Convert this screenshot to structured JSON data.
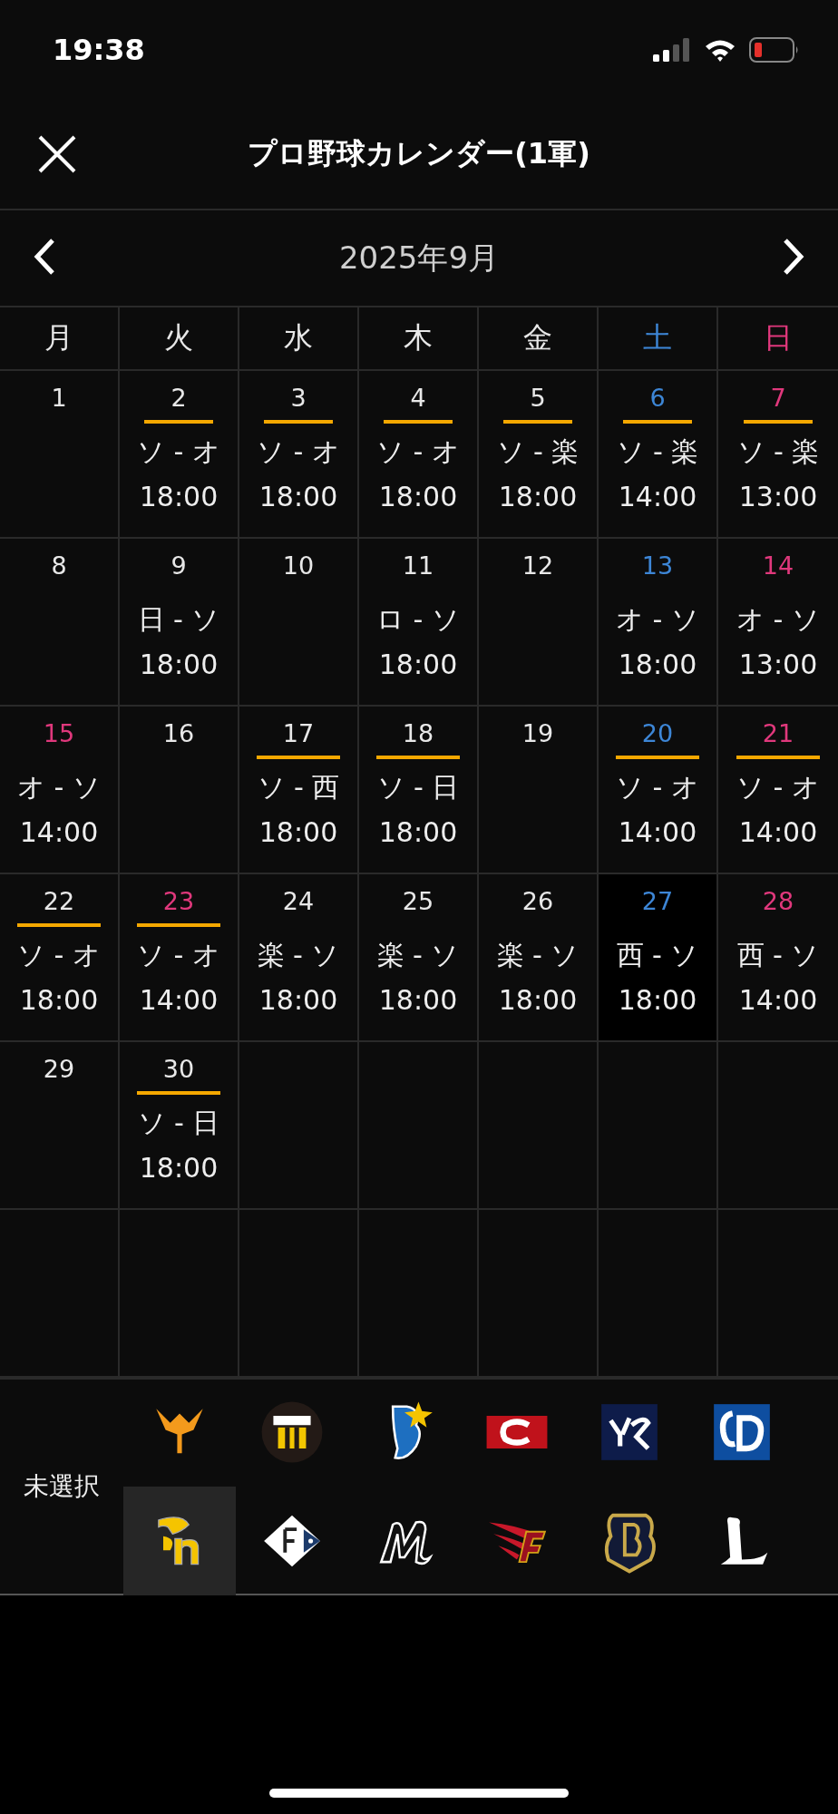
{
  "status_bar": {
    "time": "19:38"
  },
  "header": {
    "title": "プロ野球カレンダー(1軍)"
  },
  "month_nav": {
    "label": "2025年9月"
  },
  "weekdays": [
    {
      "label": "月",
      "color": "#e8e8e8"
    },
    {
      "label": "火",
      "color": "#e8e8e8"
    },
    {
      "label": "水",
      "color": "#e8e8e8"
    },
    {
      "label": "木",
      "color": "#e8e8e8"
    },
    {
      "label": "金",
      "color": "#e8e8e8"
    },
    {
      "label": "土",
      "color": "#3d86d6"
    },
    {
      "label": "日",
      "color": "#e0387c"
    }
  ],
  "weeks": [
    [
      {
        "day": "1",
        "color": "#e8e8e8",
        "home_game": false,
        "selected": false
      },
      {
        "day": "2",
        "color": "#e8e8e8",
        "home_game": true,
        "selected": false,
        "matchup": "ソ - オ",
        "time": "18:00"
      },
      {
        "day": "3",
        "color": "#e8e8e8",
        "home_game": true,
        "selected": false,
        "matchup": "ソ - オ",
        "time": "18:00"
      },
      {
        "day": "4",
        "color": "#e8e8e8",
        "home_game": true,
        "selected": false,
        "matchup": "ソ - オ",
        "time": "18:00"
      },
      {
        "day": "5",
        "color": "#e8e8e8",
        "home_game": true,
        "selected": false,
        "matchup": "ソ - 楽",
        "time": "18:00"
      },
      {
        "day": "6",
        "color": "#3d86d6",
        "home_game": true,
        "selected": false,
        "matchup": "ソ - 楽",
        "time": "14:00"
      },
      {
        "day": "7",
        "color": "#e0387c",
        "home_game": true,
        "selected": false,
        "matchup": "ソ - 楽",
        "time": "13:00"
      }
    ],
    [
      {
        "day": "8",
        "color": "#e8e8e8",
        "home_game": false,
        "selected": false
      },
      {
        "day": "9",
        "color": "#e8e8e8",
        "home_game": false,
        "selected": false,
        "matchup": "日 - ソ",
        "time": "18:00"
      },
      {
        "day": "10",
        "color": "#e8e8e8",
        "home_game": false,
        "selected": false
      },
      {
        "day": "11",
        "color": "#e8e8e8",
        "home_game": false,
        "selected": false,
        "matchup": "ロ - ソ",
        "time": "18:00"
      },
      {
        "day": "12",
        "color": "#e8e8e8",
        "home_game": false,
        "selected": false
      },
      {
        "day": "13",
        "color": "#3d86d6",
        "home_game": false,
        "selected": false,
        "matchup": "オ - ソ",
        "time": "18:00"
      },
      {
        "day": "14",
        "color": "#e0387c",
        "home_game": false,
        "selected": false,
        "matchup": "オ - ソ",
        "time": "13:00"
      }
    ],
    [
      {
        "day": "15",
        "color": "#e0387c",
        "home_game": false,
        "selected": false,
        "matchup": "オ - ソ",
        "time": "14:00"
      },
      {
        "day": "16",
        "color": "#e8e8e8",
        "home_game": false,
        "selected": false
      },
      {
        "day": "17",
        "color": "#e8e8e8",
        "home_game": true,
        "selected": false,
        "matchup": "ソ - 西",
        "time": "18:00"
      },
      {
        "day": "18",
        "color": "#e8e8e8",
        "home_game": true,
        "selected": false,
        "matchup": "ソ - 日",
        "time": "18:00"
      },
      {
        "day": "19",
        "color": "#e8e8e8",
        "home_game": false,
        "selected": false
      },
      {
        "day": "20",
        "color": "#3d86d6",
        "home_game": true,
        "selected": false,
        "matchup": "ソ - オ",
        "time": "14:00"
      },
      {
        "day": "21",
        "color": "#e0387c",
        "home_game": true,
        "selected": false,
        "matchup": "ソ - オ",
        "time": "14:00"
      }
    ],
    [
      {
        "day": "22",
        "color": "#e8e8e8",
        "home_game": true,
        "selected": false,
        "matchup": "ソ - オ",
        "time": "18:00"
      },
      {
        "day": "23",
        "color": "#e0387c",
        "home_game": true,
        "selected": false,
        "matchup": "ソ - オ",
        "time": "14:00"
      },
      {
        "day": "24",
        "color": "#e8e8e8",
        "home_game": false,
        "selected": false,
        "matchup": "楽 - ソ",
        "time": "18:00"
      },
      {
        "day": "25",
        "color": "#e8e8e8",
        "home_game": false,
        "selected": false,
        "matchup": "楽 - ソ",
        "time": "18:00"
      },
      {
        "day": "26",
        "color": "#e8e8e8",
        "home_game": false,
        "selected": false,
        "matchup": "楽 - ソ",
        "time": "18:00"
      },
      {
        "day": "27",
        "color": "#3d86d6",
        "home_game": false,
        "selected": true,
        "matchup": "西 - ソ",
        "time": "18:00"
      },
      {
        "day": "28",
        "color": "#e0387c",
        "home_game": false,
        "selected": false,
        "matchup": "西 - ソ",
        "time": "14:00"
      }
    ],
    [
      {
        "day": "29",
        "color": "#e8e8e8",
        "home_game": false,
        "selected": false
      },
      {
        "day": "30",
        "color": "#e8e8e8",
        "home_game": true,
        "selected": false,
        "matchup": "ソ - 日",
        "time": "18:00"
      }
    ]
  ],
  "team_filter": {
    "label": "未選択",
    "teams": [
      {
        "selected": false
      },
      {
        "selected": false
      },
      {
        "selected": false
      },
      {
        "selected": false
      },
      {
        "selected": false
      },
      {
        "selected": false
      },
      {
        "selected": true
      },
      {
        "selected": false
      },
      {
        "selected": false
      },
      {
        "selected": false
      },
      {
        "selected": false
      },
      {
        "selected": false
      }
    ]
  }
}
